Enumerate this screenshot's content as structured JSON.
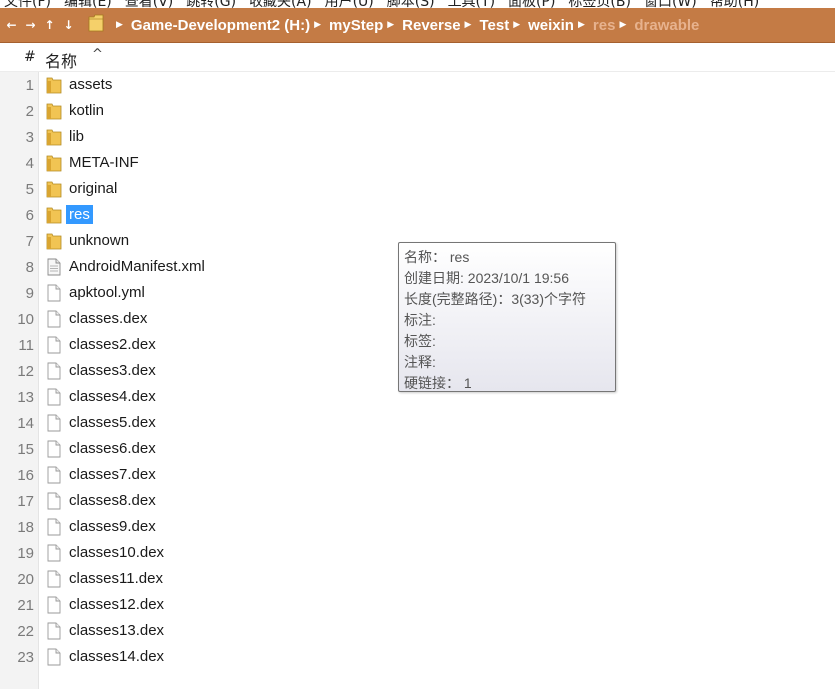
{
  "menubar": {
    "items": [
      "文件(F)",
      "编辑(E)",
      "查看(V)",
      "跳转(G)",
      "收藏夹(A)",
      "用户(U)",
      "脚本(S)",
      "工具(T)",
      "面板(P)",
      "标签页(B)",
      "窗口(W)",
      "帮助(H)"
    ]
  },
  "navbar": {
    "back": "←",
    "forward": "→",
    "up": "↑",
    "down": "↓",
    "breadcrumbs": [
      {
        "label": "Game-Development2 (H:)",
        "dim": false
      },
      {
        "label": "myStep",
        "dim": false
      },
      {
        "label": "Reverse",
        "dim": false
      },
      {
        "label": "Test",
        "dim": false
      },
      {
        "label": "weixin",
        "dim": false
      },
      {
        "label": "res",
        "dim": true
      },
      {
        "label": "drawable",
        "dim": true
      }
    ]
  },
  "header": {
    "hash": "#",
    "name_column": "名称",
    "sort_indicator": "^"
  },
  "files": [
    {
      "num": "1",
      "name": "assets",
      "type": "folder",
      "selected": false
    },
    {
      "num": "2",
      "name": "kotlin",
      "type": "folder",
      "selected": false
    },
    {
      "num": "3",
      "name": "lib",
      "type": "folder",
      "selected": false
    },
    {
      "num": "4",
      "name": "META-INF",
      "type": "folder",
      "selected": false
    },
    {
      "num": "5",
      "name": "original",
      "type": "folder",
      "selected": false
    },
    {
      "num": "6",
      "name": "res",
      "type": "folder",
      "selected": true
    },
    {
      "num": "7",
      "name": "unknown",
      "type": "folder",
      "selected": false
    },
    {
      "num": "8",
      "name": "AndroidManifest.xml",
      "type": "xml",
      "selected": false
    },
    {
      "num": "9",
      "name": "apktool.yml",
      "type": "file",
      "selected": false
    },
    {
      "num": "10",
      "name": "classes.dex",
      "type": "file",
      "selected": false
    },
    {
      "num": "11",
      "name": "classes2.dex",
      "type": "file",
      "selected": false
    },
    {
      "num": "12",
      "name": "classes3.dex",
      "type": "file",
      "selected": false
    },
    {
      "num": "13",
      "name": "classes4.dex",
      "type": "file",
      "selected": false
    },
    {
      "num": "14",
      "name": "classes5.dex",
      "type": "file",
      "selected": false
    },
    {
      "num": "15",
      "name": "classes6.dex",
      "type": "file",
      "selected": false
    },
    {
      "num": "16",
      "name": "classes7.dex",
      "type": "file",
      "selected": false
    },
    {
      "num": "17",
      "name": "classes8.dex",
      "type": "file",
      "selected": false
    },
    {
      "num": "18",
      "name": "classes9.dex",
      "type": "file",
      "selected": false
    },
    {
      "num": "19",
      "name": "classes10.dex",
      "type": "file",
      "selected": false
    },
    {
      "num": "20",
      "name": "classes11.dex",
      "type": "file",
      "selected": false
    },
    {
      "num": "21",
      "name": "classes12.dex",
      "type": "file",
      "selected": false
    },
    {
      "num": "22",
      "name": "classes13.dex",
      "type": "file",
      "selected": false
    },
    {
      "num": "23",
      "name": "classes14.dex",
      "type": "file",
      "selected": false
    }
  ],
  "tooltip": {
    "lines": [
      "名称： res",
      "创建日期: 2023/10/1 19:56",
      "长度(完整路径)：3(33)个字符",
      "标注:",
      "标签:",
      "注释:",
      "硬链接： 1"
    ]
  },
  "colors": {
    "navbar_bg": "#c47b45",
    "selection": "#3399ff",
    "folder": "#e8b84a"
  }
}
